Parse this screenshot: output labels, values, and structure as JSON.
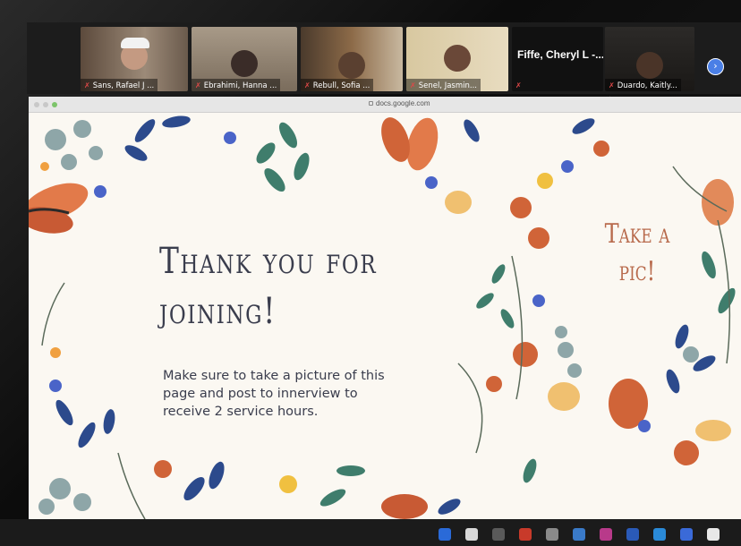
{
  "meeting": {
    "participants": [
      {
        "name": "Sans, Rafael J ..."
      },
      {
        "name": "Ebrahimi, Hanna ..."
      },
      {
        "name": "Rebull, Sofia ..."
      },
      {
        "name": "Senel, Jasmin..."
      },
      {
        "name": "Fiffe, Cheryl L -..."
      },
      {
        "name": "Duardo, Kaitly..."
      }
    ],
    "next_icon": "chevron-right-icon",
    "muted_icon": "mic-off-icon"
  },
  "browser": {
    "url": "docs.google.com"
  },
  "slide": {
    "title_line1": "Thank you for",
    "title_line2": "joining!",
    "body": "Make sure to take a picture of this page and post to innerview to receive 2 service hours.",
    "side_line1": "Take a",
    "side_line2": "pic!",
    "colors": {
      "text": "#3a3d4d",
      "accent": "#b86a4c",
      "background": "#fbf8f2"
    }
  }
}
